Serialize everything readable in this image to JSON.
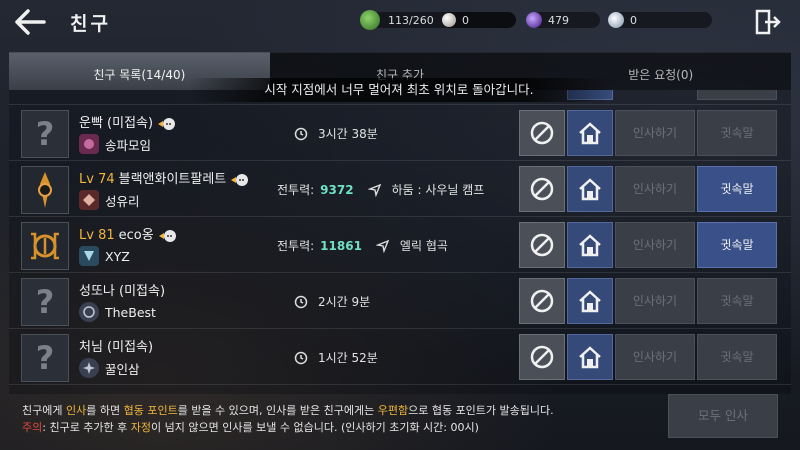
{
  "header": {
    "title": "친구",
    "resources": [
      {
        "icon": "green-leaf-icon",
        "value": "113/260",
        "color": "#4fa53a"
      },
      {
        "icon": "pearl-icon",
        "value": "0",
        "color": "#c9bfb8"
      },
      {
        "icon": "purple-gem-icon",
        "value": "479",
        "color": "#6a3ad0"
      },
      {
        "icon": "silver-coin-icon",
        "value": "0",
        "color": "#b8c8d8"
      }
    ]
  },
  "tabs": [
    {
      "label": "친구 목록(14/40)",
      "active": true
    },
    {
      "label": "친구 추가",
      "active": false
    },
    {
      "label": "받은 요청(0)",
      "active": false
    }
  ],
  "toast": "시작 지점에서 너무 멀어져 최초 위치로 돌아갑니다.",
  "friends": [
    {
      "level": "",
      "name": "운빡 (미접속)",
      "guild": "송파모임",
      "info_type": "time",
      "info": "3시간 38분",
      "whisper": "귓속말",
      "whisper_on": false,
      "greet": "인사하기"
    },
    {
      "level": "Lv 74",
      "name": "블랙앤화이트팔레트",
      "guild": "성유리",
      "info_type": "power",
      "power_label": "전투력:",
      "power": "9372",
      "location": "하둠 : 사우닐 캠프",
      "whisper": "귓속말",
      "whisper_on": true,
      "greet": "인사하기"
    },
    {
      "level": "Lv 81",
      "name": "eco옹",
      "guild": "XYZ",
      "info_type": "power",
      "power_label": "전투력:",
      "power": "11861",
      "location": "엘릭 협곡",
      "whisper": "귓속말",
      "whisper_on": true,
      "greet": "인사하기"
    },
    {
      "level": "",
      "name": "성또나 (미접속)",
      "guild": "TheBest",
      "info_type": "time",
      "info": "2시간 9분",
      "whisper": "귓속말",
      "whisper_on": false,
      "greet": "인사하기"
    },
    {
      "level": "",
      "name": "처님 (미접속)",
      "guild": "꿀인삼",
      "info_type": "time",
      "info": "1시간 52분",
      "whisper": "귓속말",
      "whisper_on": false,
      "greet": "인사하기"
    }
  ],
  "footer": {
    "line1": [
      {
        "t": "친구에게 ",
        "c": ""
      },
      {
        "t": "인사",
        "c": "hl"
      },
      {
        "t": "를 하면 ",
        "c": ""
      },
      {
        "t": "협동 포인트",
        "c": "hl"
      },
      {
        "t": "를 받을 수 있으며, 인사를 받은 친구에게는 ",
        "c": ""
      },
      {
        "t": "우편함",
        "c": "hl"
      },
      {
        "t": "으로 협동 포인트가 발송됩니다.",
        "c": ""
      }
    ],
    "line2": [
      {
        "t": "주의",
        "c": "warn"
      },
      {
        "t": ": 친구로 추가한 후 ",
        "c": ""
      },
      {
        "t": "자정",
        "c": "hl"
      },
      {
        "t": "이 넘지 않으면 인사를 보낼 수 없습니다. (인사하기 초기화 시간: 00시)",
        "c": ""
      }
    ],
    "all_greet": "모두 인사"
  }
}
